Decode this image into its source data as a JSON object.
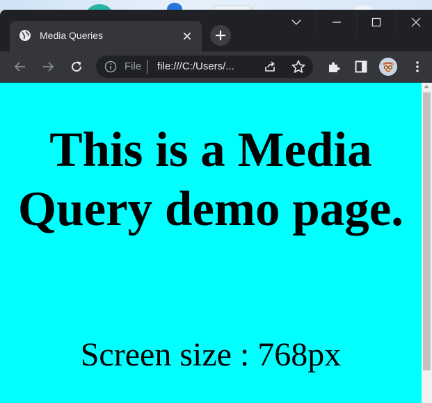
{
  "window": {
    "tab_title": "Media Queries"
  },
  "toolbar": {
    "scheme_label": "File",
    "url": "file:///C:/Users/..."
  },
  "page": {
    "heading": "This is a Media Query demo page.",
    "subtext": "Screen size : 768px",
    "background_color": "#00ffff"
  },
  "icons": {
    "favicon": "globe-icon",
    "tab_close": "close-icon",
    "new_tab": "plus-icon",
    "tab_list": "chevron-down-icon",
    "minimize": "minimize-icon",
    "maximize": "maximize-icon",
    "close_window": "close-icon",
    "back": "arrow-left-icon",
    "forward": "arrow-right-icon",
    "reload": "reload-icon",
    "site_info": "info-icon",
    "share": "share-icon",
    "bookmark": "star-icon",
    "extensions": "puzzle-icon",
    "side_panel": "side-panel-icon",
    "profile": "avatar",
    "menu": "kebab-menu-icon"
  }
}
